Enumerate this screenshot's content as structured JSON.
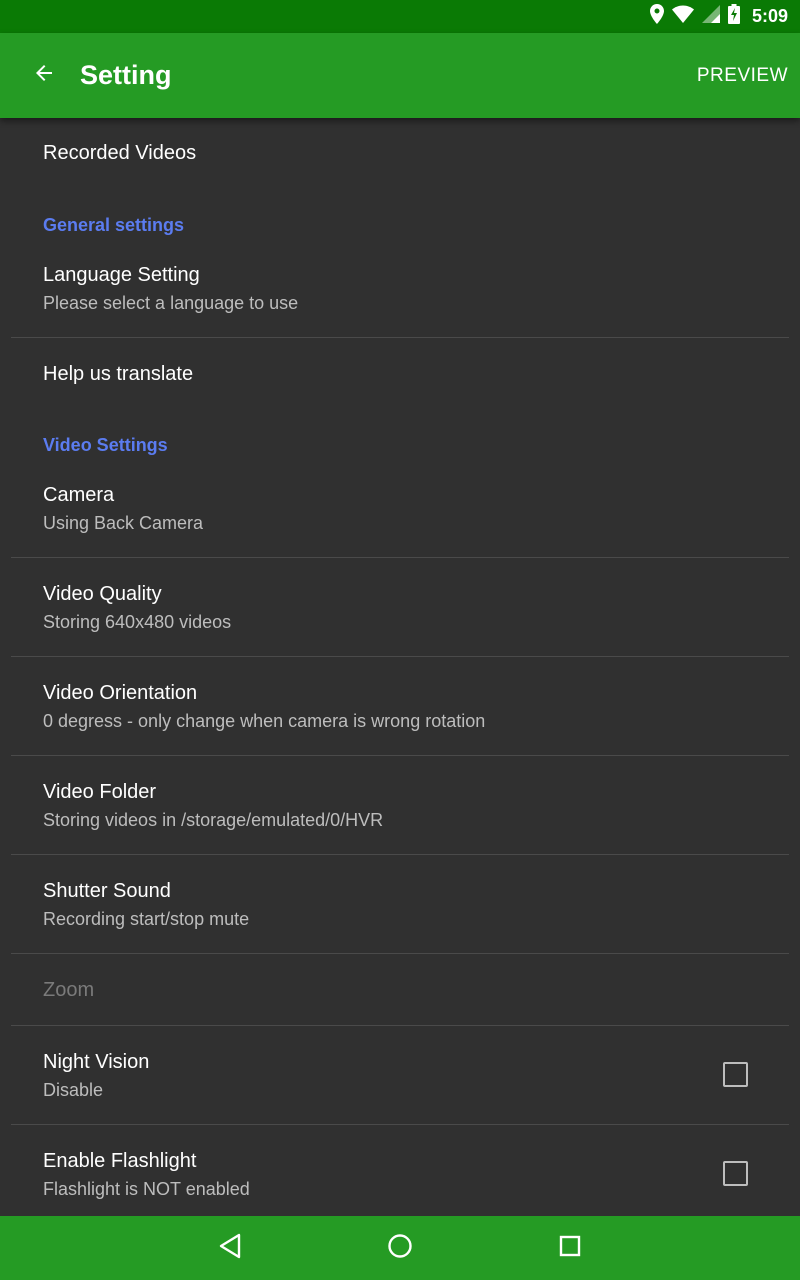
{
  "status_bar": {
    "time": "5:09",
    "icons": [
      "location-icon",
      "wifi-icon",
      "signal-icon",
      "battery-charging-icon"
    ]
  },
  "app_bar": {
    "title": "Setting",
    "action": "PREVIEW",
    "back_icon": "arrow-back-icon"
  },
  "items": {
    "recorded_videos": {
      "title": "Recorded Videos"
    },
    "general_header": "General settings",
    "language": {
      "title": "Language Setting",
      "summary": "Please select a language to use"
    },
    "translate": {
      "title": "Help us translate"
    },
    "video_header": "Video Settings",
    "camera": {
      "title": "Camera",
      "summary": "Using Back Camera"
    },
    "video_quality": {
      "title": "Video Quality",
      "summary": "Storing 640x480 videos"
    },
    "video_orientation": {
      "title": "Video Orientation",
      "summary": "0 degress - only change when camera is wrong rotation"
    },
    "video_folder": {
      "title": "Video Folder",
      "summary": "Storing videos in /storage/emulated/0/HVR"
    },
    "shutter_sound": {
      "title": "Shutter Sound",
      "summary": "Recording start/stop mute"
    },
    "zoom": {
      "title": "Zoom"
    },
    "night_vision": {
      "title": "Night Vision",
      "summary": "Disable",
      "checked": false
    },
    "flashlight": {
      "title": "Enable Flashlight",
      "summary": "Flashlight is NOT enabled",
      "checked": false
    }
  },
  "nav_bar": {
    "icons": [
      "back-triangle-icon",
      "home-circle-icon",
      "recents-square-icon"
    ]
  },
  "colors": {
    "status_bar": "#0a7a05",
    "app_bar": "#259b24",
    "background": "#303030",
    "section_header": "#5b7cf0"
  }
}
